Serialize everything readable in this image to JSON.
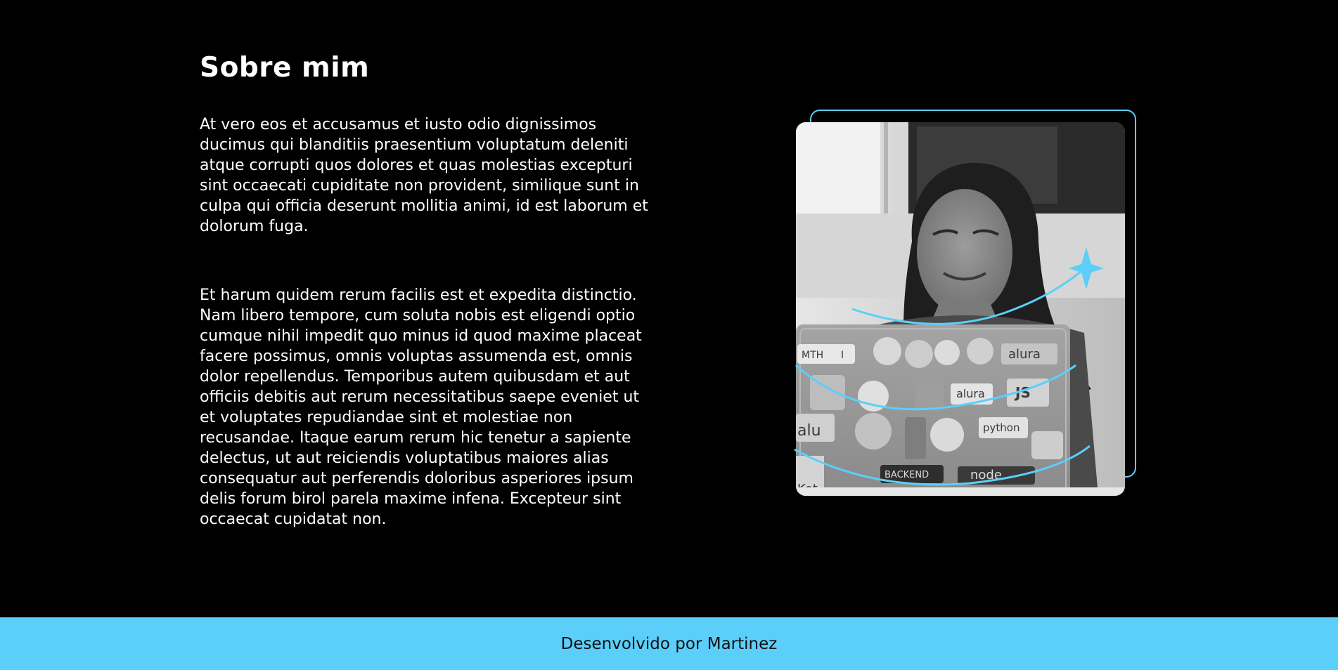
{
  "about": {
    "title": "Sobre mim",
    "paragraphs": [
      "At vero eos et accusamus et iusto odio dignissimos ducimus qui blanditiis praesentium voluptatum deleniti atque corrupti quos dolores et quas molestias excepturi sint occaecati cupiditate non provident, similique sunt in culpa qui officia deserunt mollitia animi, id est laborum et dolorum fuga.",
      "Et harum quidem rerum facilis est et expedita distinctio. Nam libero tempore, cum soluta nobis est eligendi optio cumque nihil impedit quo minus id quod maxime placeat facere possimus, omnis voluptas assumenda est, omnis dolor repellendus. Temporibus autem quibusdam et aut officiis debitis aut rerum necessitatibus saepe eveniet ut et voluptates repudiandae sint et molestiae non recusandae. Itaque earum rerum hic tenetur a sapiente delectus, ut aut reiciendis voluptatibus maiores alias consequatur aut perferendis doloribus asperiores ipsum delis forum birol parela maxime infena. Excepteur sint occaecat cupidatat non."
    ],
    "photo": {
      "laptop_sticker_texts": [
        "MTH",
        "I",
        "alura",
        "JS",
        "alura",
        "python",
        "alu",
        "BACKEND",
        "node",
        "Kot"
      ]
    }
  },
  "footer": {
    "text": "Desenvolvido por Martinez"
  },
  "colors": {
    "background": "#000000",
    "accent": "#5bcffa",
    "text": "#ffffff",
    "footer_text": "#111111"
  }
}
